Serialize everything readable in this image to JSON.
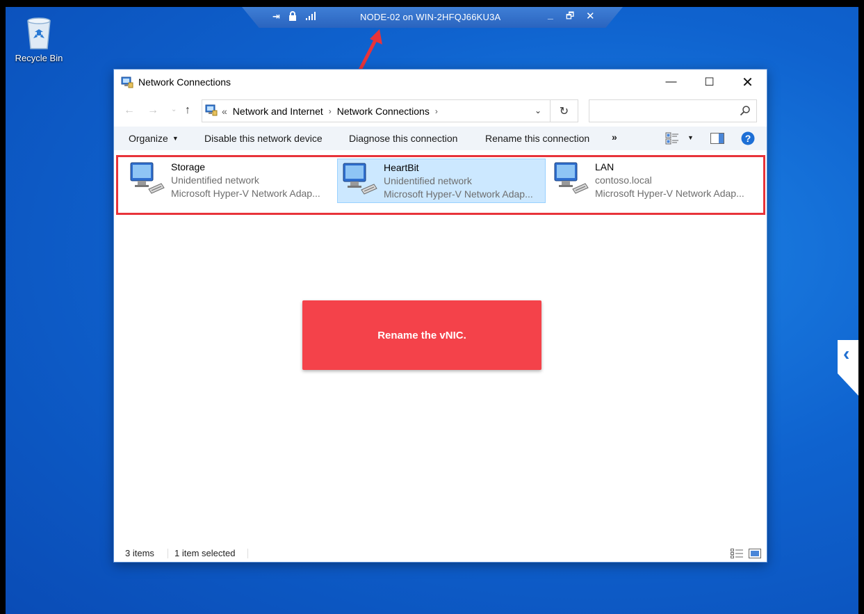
{
  "desktop": {
    "recycle_bin_label": "Recycle Bin"
  },
  "rdp_bar": {
    "title": "NODE-02 on WIN-2HFQJ66KU3A",
    "pin_glyph": "⇥",
    "minimize_glyph": "_",
    "restore_glyph": "🗗",
    "close_glyph": "✕"
  },
  "window": {
    "title": "Network Connections",
    "minimize_glyph": "—",
    "maximize_glyph": "☐",
    "close_glyph": "✕"
  },
  "address_bar": {
    "overflow_glyph": "«",
    "crumbs": [
      "Network and Internet",
      "Network Connections"
    ],
    "separator": "›",
    "dropdown_glyph": "⌄",
    "refresh_glyph": "↻",
    "search_placeholder": ""
  },
  "nav": {
    "back_glyph": "←",
    "forward_glyph": "→",
    "recent_glyph": "⌄",
    "up_glyph": "↑"
  },
  "command_bar": {
    "organize": "Organize",
    "organize_caret": "▼",
    "disable": "Disable this network device",
    "diagnose": "Diagnose this connection",
    "rename": "Rename this connection",
    "more": "»",
    "view_caret": "▼"
  },
  "adapters": [
    {
      "name": "Storage",
      "network": "Unidentified network",
      "device": "Microsoft Hyper-V Network Adap...",
      "selected": false
    },
    {
      "name": "HeartBit",
      "network": "Unidentified network",
      "device": "Microsoft Hyper-V Network Adap...",
      "selected": true
    },
    {
      "name": "LAN",
      "network": "contoso.local",
      "device": "Microsoft Hyper-V Network Adap...",
      "selected": false
    }
  ],
  "callout": {
    "text": "Rename the vNIC."
  },
  "status_bar": {
    "item_count": "3 items",
    "selection": "1 item selected"
  },
  "side_tab": {
    "glyph": "‹"
  },
  "colors": {
    "highlight_border": "#e8333a",
    "callout_bg": "#f4424a",
    "selection_bg": "#cce8ff",
    "desktop_blue": "#0f63cf"
  },
  "icons": [
    "recycle-bin-icon",
    "network-adapter-icon",
    "search-icon",
    "help-icon",
    "lock-icon",
    "signal-icon"
  ]
}
